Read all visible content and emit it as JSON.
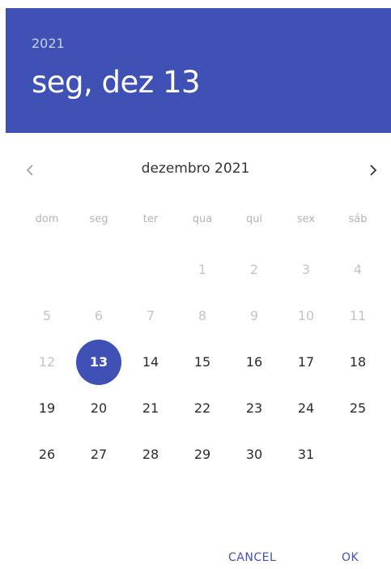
{
  "header": {
    "year": "2021",
    "selected_date": "seg, dez 13",
    "background_color": "#3f51b5"
  },
  "calendar": {
    "month_label": "dezembro 2021",
    "prev_icon": "chevron-left-icon",
    "next_icon": "chevron-right-icon",
    "weekdays": [
      "dom",
      "seg",
      "ter",
      "qua",
      "qui",
      "sex",
      "sáb"
    ],
    "weeks": [
      [
        "",
        "",
        "",
        "1",
        "2",
        "3",
        "4"
      ],
      [
        "5",
        "6",
        "7",
        "8",
        "9",
        "10",
        "11"
      ],
      [
        "12",
        "13",
        "14",
        "15",
        "16",
        "17",
        "18"
      ],
      [
        "19",
        "20",
        "21",
        "22",
        "23",
        "24",
        "25"
      ],
      [
        "26",
        "27",
        "28",
        "29",
        "30",
        "31",
        ""
      ]
    ],
    "disabled_days": [
      "1",
      "2",
      "3",
      "4",
      "5",
      "6",
      "7",
      "8",
      "9",
      "10",
      "11",
      "12"
    ],
    "selected_day": "13",
    "accent_color": "#3f51b5"
  },
  "actions": {
    "cancel_label": "CANCEL",
    "ok_label": "OK"
  }
}
